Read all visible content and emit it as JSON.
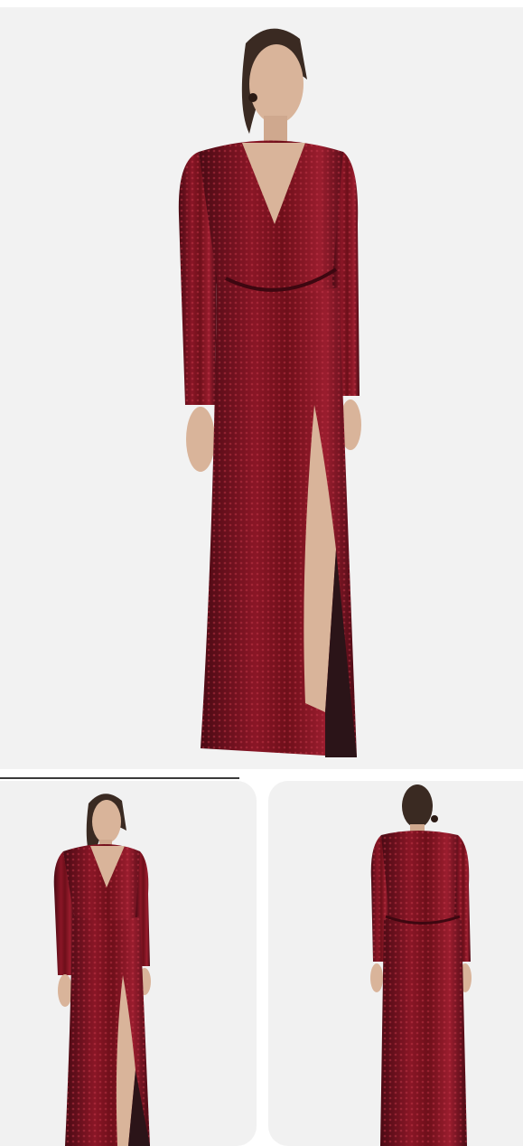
{
  "product": {
    "colors": {
      "dress": "#6e0f1a",
      "dress_dark": "#3d0710",
      "dress_highlight": "#b4283a",
      "skin": "#d9b49a",
      "hair": "#3a2a22",
      "background": "#f2f2f2"
    }
  },
  "gallery": {
    "views": [
      "front-hero",
      "front-thumbnail",
      "back-thumbnail"
    ]
  }
}
